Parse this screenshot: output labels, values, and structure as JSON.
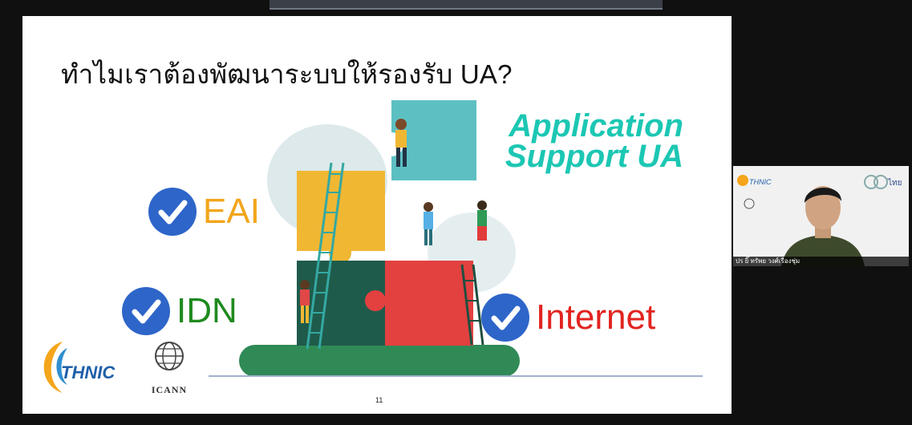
{
  "slide": {
    "title": "ทำไมเราต้องพัฒนาระบบให้รองรับ UA?",
    "subtitle_line1": "Application",
    "subtitle_line2": "Support UA",
    "items": [
      {
        "label": "EAI",
        "color": "#f2a51b"
      },
      {
        "label": "IDN",
        "color": "#1e8a1e"
      },
      {
        "label": "Internet",
        "color": "#e12420"
      }
    ],
    "page_number": "11",
    "logos": {
      "thnic_text": "THNIC",
      "icann_text": "ICANN"
    }
  },
  "video_tile": {
    "logo_left": "THNIC",
    "logo_right": "ไทย",
    "participant_name": "ปร ยิ๊ ทรัพย วงศ์เรืองชุ่ม"
  },
  "colors": {
    "accent_teal": "#1cc7b3",
    "check_blue": "#2e65c9"
  }
}
